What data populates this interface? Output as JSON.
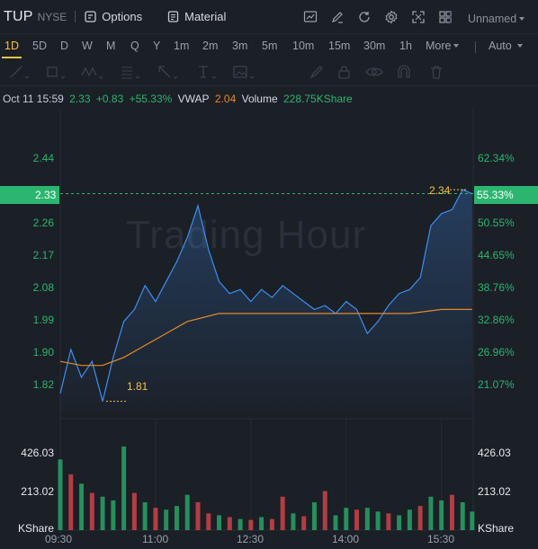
{
  "header": {
    "symbol": "TUP",
    "exchange": "NYSE",
    "options_label": "Options",
    "material_label": "Material",
    "layout_name": "Unnamed"
  },
  "toolbar_icons": [
    "chart-icon",
    "pen-icon",
    "refresh-icon",
    "gear-icon",
    "fullscreen-icon",
    "grid-icon"
  ],
  "periods": [
    "1D",
    "5D",
    "D",
    "W",
    "M",
    "Q",
    "Y",
    "1m",
    "2m",
    "3m",
    "5m",
    "10m",
    "15m",
    "30m",
    "1h"
  ],
  "active_period": "1D",
  "more_label": "More",
  "scale_mode": "Auto",
  "drawing_tools": [
    "line-tool-icon",
    "rect-tool-icon",
    "pattern-tool-icon",
    "fib-tool-icon",
    "arrow-tool-icon",
    "text-tool-icon",
    "image-tool-icon",
    "brush-tool-icon",
    "lock-tool-icon",
    "eye-tool-icon",
    "magnet-tool-icon",
    "trash-tool-icon"
  ],
  "info_bar": {
    "datetime": "Oct 11 15:59",
    "price": "2.33",
    "change": "+0.83",
    "change_pct": "+55.33%",
    "vwap_label": "VWAP",
    "vwap_value": "2.04",
    "volume_label": "Volume",
    "volume_value": "228.75KShare"
  },
  "watermark": "Trading Hour",
  "colors": {
    "up": "#2bb56f",
    "down": "#e5484d",
    "price_line": "#3d8ef0",
    "vwap_line": "#e48a2a",
    "highlight": "#f5c342",
    "background": "#1b1f26"
  },
  "price_axis": {
    "left_labels": [
      "2.44",
      "2.26",
      "2.17",
      "2.08",
      "1.99",
      "1.90",
      "1.82"
    ],
    "right_labels": [
      "62.34%",
      "50.55%",
      "44.65%",
      "38.76%",
      "32.86%",
      "26.96%",
      "21.07%"
    ],
    "current_price": "2.33",
    "current_pct": "55.33%",
    "high_label": "2.34",
    "low_label": "1.81"
  },
  "volume_axis": {
    "labels": [
      "426.03",
      "213.02"
    ],
    "unit": "KShare"
  },
  "time_axis": [
    "09:30",
    "11:00",
    "12:30",
    "14:00",
    "15:30"
  ],
  "chart_data": {
    "type": "line",
    "series": [
      {
        "name": "Price",
        "points": [
          [
            "09:30",
            1.83
          ],
          [
            "09:40",
            1.94
          ],
          [
            "09:50",
            1.87
          ],
          [
            "10:00",
            1.91
          ],
          [
            "10:10",
            1.81
          ],
          [
            "10:20",
            1.92
          ],
          [
            "10:30",
            2.01
          ],
          [
            "10:40",
            2.04
          ],
          [
            "10:50",
            2.1
          ],
          [
            "11:00",
            2.06
          ],
          [
            "11:10",
            2.11
          ],
          [
            "11:20",
            2.16
          ],
          [
            "11:30",
            2.22
          ],
          [
            "11:40",
            2.3
          ],
          [
            "11:50",
            2.19
          ],
          [
            "12:00",
            2.11
          ],
          [
            "12:10",
            2.08
          ],
          [
            "12:20",
            2.09
          ],
          [
            "12:30",
            2.06
          ],
          [
            "12:40",
            2.09
          ],
          [
            "12:50",
            2.07
          ],
          [
            "13:00",
            2.1
          ],
          [
            "13:10",
            2.08
          ],
          [
            "13:20",
            2.06
          ],
          [
            "13:30",
            2.04
          ],
          [
            "13:40",
            2.05
          ],
          [
            "13:50",
            2.03
          ],
          [
            "14:00",
            2.06
          ],
          [
            "14:10",
            2.04
          ],
          [
            "14:20",
            1.98
          ],
          [
            "14:30",
            2.01
          ],
          [
            "14:40",
            2.05
          ],
          [
            "14:50",
            2.08
          ],
          [
            "15:00",
            2.09
          ],
          [
            "15:10",
            2.12
          ],
          [
            "15:20",
            2.25
          ],
          [
            "15:30",
            2.28
          ],
          [
            "15:40",
            2.29
          ],
          [
            "15:50",
            2.34
          ],
          [
            "15:59",
            2.33
          ]
        ]
      },
      {
        "name": "VWAP",
        "points": [
          [
            "09:30",
            1.91
          ],
          [
            "09:50",
            1.9
          ],
          [
            "10:10",
            1.9
          ],
          [
            "10:30",
            1.92
          ],
          [
            "10:50",
            1.95
          ],
          [
            "11:10",
            1.98
          ],
          [
            "11:30",
            2.01
          ],
          [
            "12:00",
            2.03
          ],
          [
            "12:30",
            2.03
          ],
          [
            "13:00",
            2.03
          ],
          [
            "13:30",
            2.03
          ],
          [
            "14:00",
            2.03
          ],
          [
            "14:30",
            2.03
          ],
          [
            "15:00",
            2.03
          ],
          [
            "15:30",
            2.04
          ],
          [
            "15:59",
            2.04
          ]
        ]
      }
    ],
    "volume": [
      {
        "t": "09:30",
        "v": 380,
        "dir": "up"
      },
      {
        "t": "09:40",
        "v": 300,
        "dir": "down"
      },
      {
        "t": "09:50",
        "v": 250,
        "dir": "up"
      },
      {
        "t": "10:00",
        "v": 200,
        "dir": "down"
      },
      {
        "t": "10:10",
        "v": 180,
        "dir": "up"
      },
      {
        "t": "10:20",
        "v": 160,
        "dir": "up"
      },
      {
        "t": "10:30",
        "v": 450,
        "dir": "up"
      },
      {
        "t": "10:40",
        "v": 200,
        "dir": "down"
      },
      {
        "t": "10:50",
        "v": 150,
        "dir": "up"
      },
      {
        "t": "11:00",
        "v": 120,
        "dir": "down"
      },
      {
        "t": "11:10",
        "v": 110,
        "dir": "up"
      },
      {
        "t": "11:20",
        "v": 130,
        "dir": "up"
      },
      {
        "t": "11:30",
        "v": 190,
        "dir": "up"
      },
      {
        "t": "11:40",
        "v": 150,
        "dir": "down"
      },
      {
        "t": "11:50",
        "v": 90,
        "dir": "down"
      },
      {
        "t": "12:00",
        "v": 80,
        "dir": "up"
      },
      {
        "t": "12:10",
        "v": 70,
        "dir": "down"
      },
      {
        "t": "12:20",
        "v": 60,
        "dir": "up"
      },
      {
        "t": "12:30",
        "v": 55,
        "dir": "down"
      },
      {
        "t": "12:40",
        "v": 70,
        "dir": "up"
      },
      {
        "t": "12:50",
        "v": 60,
        "dir": "down"
      },
      {
        "t": "13:00",
        "v": 180,
        "dir": "down"
      },
      {
        "t": "13:10",
        "v": 90,
        "dir": "up"
      },
      {
        "t": "13:20",
        "v": 75,
        "dir": "down"
      },
      {
        "t": "13:30",
        "v": 150,
        "dir": "up"
      },
      {
        "t": "13:40",
        "v": 210,
        "dir": "down"
      },
      {
        "t": "13:50",
        "v": 80,
        "dir": "up"
      },
      {
        "t": "14:00",
        "v": 120,
        "dir": "up"
      },
      {
        "t": "14:10",
        "v": 110,
        "dir": "down"
      },
      {
        "t": "14:20",
        "v": 120,
        "dir": "up"
      },
      {
        "t": "14:30",
        "v": 100,
        "dir": "up"
      },
      {
        "t": "14:40",
        "v": 90,
        "dir": "down"
      },
      {
        "t": "14:50",
        "v": 80,
        "dir": "up"
      },
      {
        "t": "15:00",
        "v": 110,
        "dir": "up"
      },
      {
        "t": "15:10",
        "v": 130,
        "dir": "down"
      },
      {
        "t": "15:20",
        "v": 180,
        "dir": "up"
      },
      {
        "t": "15:30",
        "v": 160,
        "dir": "up"
      },
      {
        "t": "15:40",
        "v": 190,
        "dir": "down"
      },
      {
        "t": "15:50",
        "v": 150,
        "dir": "up"
      },
      {
        "t": "15:59",
        "v": 100,
        "dir": "up"
      }
    ],
    "x_range": [
      "09:30",
      "16:00"
    ],
    "y_range": [
      1.78,
      2.5
    ],
    "volume_range": [
      0,
      580
    ]
  }
}
